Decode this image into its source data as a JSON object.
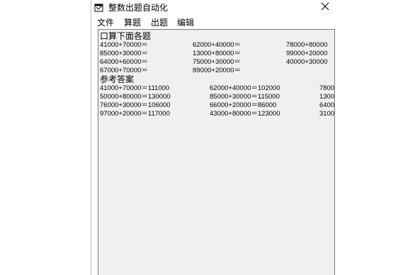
{
  "window": {
    "title": "整数出题自动化"
  },
  "menu": {
    "items": [
      "文件",
      "算题",
      "出题",
      "编辑"
    ]
  },
  "content": {
    "questions_heading": "口算下面各题",
    "questions": [
      [
        "41000+70000＝",
        "62000+40000＝",
        "78000+80000"
      ],
      [
        "85000+30000＝",
        "13000+80000＝",
        "99000+20000"
      ],
      [
        "64000+60000＝",
        "75000+30000＝",
        "40000+30000"
      ],
      [
        "67000+70000＝",
        "89000+20000＝",
        ""
      ]
    ],
    "answers_heading": "参考答案",
    "answers": [
      [
        "41000+70000＝111000",
        "62000+40000＝102000",
        "7800"
      ],
      [
        "50000+80000＝130000",
        "85000+30000＝115000",
        "1300"
      ],
      [
        "76000+30000＝106000",
        "66000+20000＝86000",
        "6400"
      ],
      [
        "97000+20000＝117000",
        "43000+80000＝123000",
        "3100"
      ]
    ]
  },
  "colors": {
    "client_bg": "#f0f0f0",
    "border": "#7a7a7a"
  },
  "icons": {
    "app": "app-window-icon",
    "close": "close-icon"
  }
}
